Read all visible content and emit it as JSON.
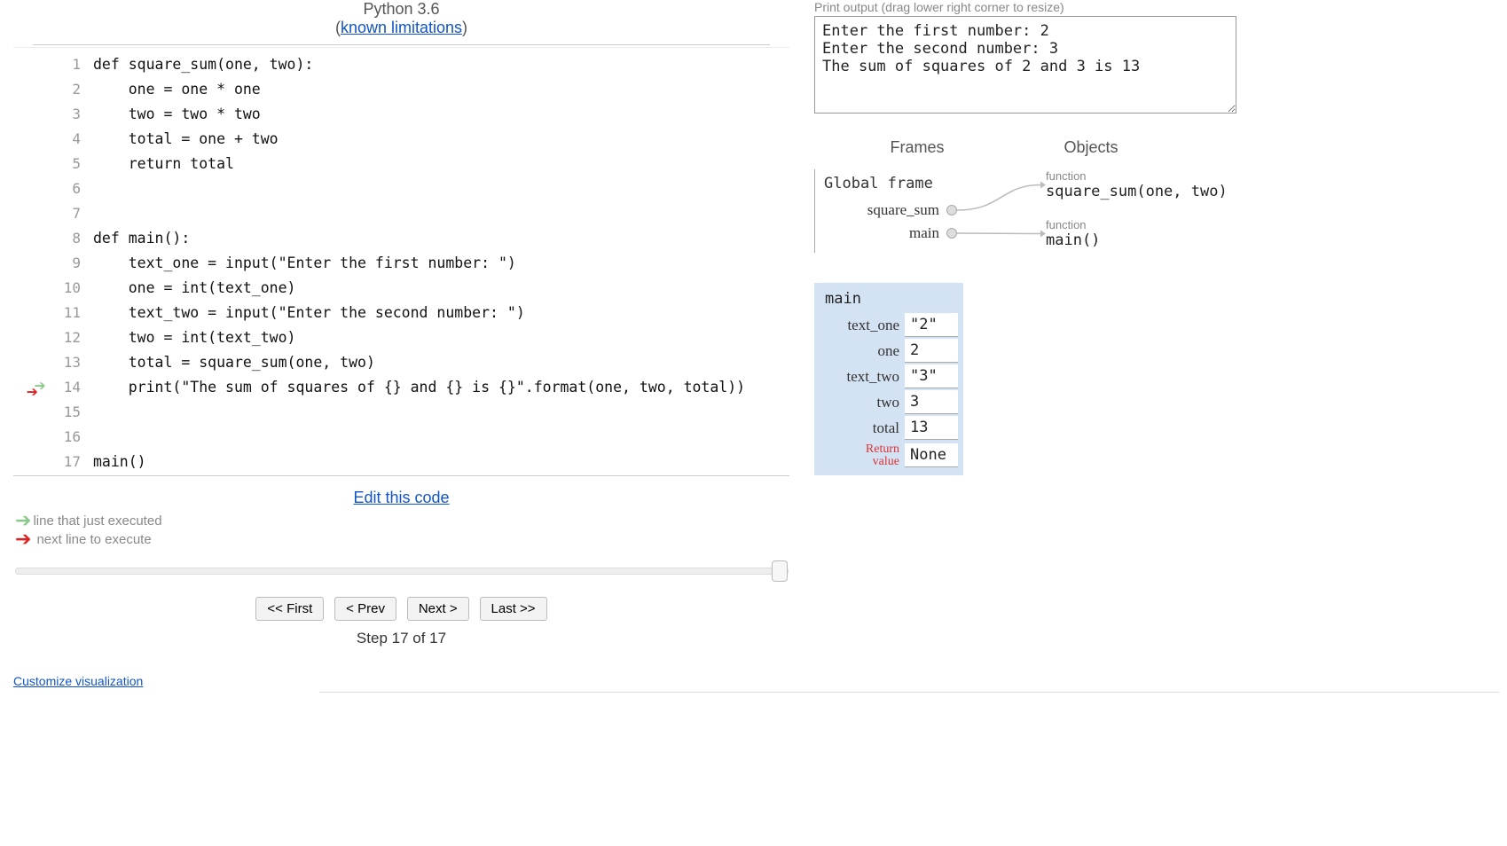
{
  "header": {
    "lang": "Python 3.6",
    "limitations": "known limitations"
  },
  "code": {
    "lines": [
      "def square_sum(one, two):",
      "    one = one * one",
      "    two = two * two",
      "    total = one + two",
      "    return total",
      "",
      "",
      "def main():",
      "    text_one = input(\"Enter the first number: \")",
      "    one = int(text_one)",
      "    text_two = input(\"Enter the second number: \")",
      "    two = int(text_two)",
      "    total = square_sum(one, two)",
      "    print(\"The sum of squares of {} and {} is {}\".format(one, two, total))",
      "",
      "",
      "main()"
    ],
    "prev_line": 14,
    "cur_line": 14
  },
  "edit_link": "Edit this code",
  "legend": {
    "prev": "line that just executed",
    "next": "next line to execute"
  },
  "nav": {
    "first": "<< First",
    "prev": "< Prev",
    "next": "Next >",
    "last": "Last >>",
    "step_label": "Step 17 of 17",
    "step": 17,
    "total_steps": 17
  },
  "customize": "Customize visualization",
  "output": {
    "title": "Print output (drag lower right corner to resize)",
    "text": "Enter the first number: 2\nEnter the second number: 3\nThe sum of squares of 2 and 3 is 13"
  },
  "fo": {
    "frames": "Frames",
    "objects": "Objects"
  },
  "global": {
    "title": "Global frame",
    "vars": [
      "square_sum",
      "main"
    ]
  },
  "objects": [
    {
      "label": "function",
      "value": "square_sum(one, two)"
    },
    {
      "label": "function",
      "value": "main()"
    }
  ],
  "main_frame": {
    "title": "main",
    "rows": [
      {
        "name": "text_one",
        "val": "\"2\""
      },
      {
        "name": "one",
        "val": "2"
      },
      {
        "name": "text_two",
        "val": "\"3\""
      },
      {
        "name": "two",
        "val": "3"
      },
      {
        "name": "total",
        "val": "13"
      }
    ],
    "return": {
      "name": "Return\nvalue",
      "val": "None"
    }
  }
}
